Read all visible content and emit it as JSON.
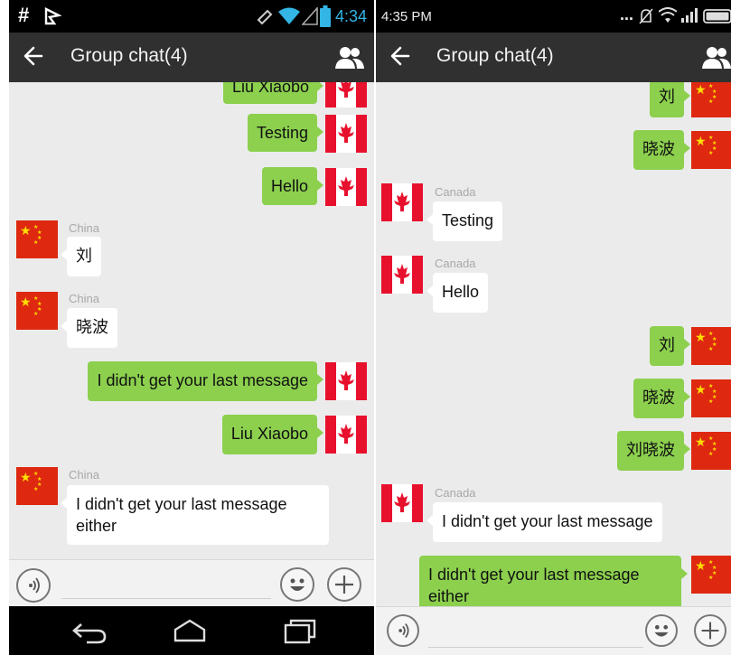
{
  "left_screen": {
    "status": {
      "time": "4:34",
      "hash_icon": "#"
    },
    "header": {
      "title": "Group chat(4)"
    },
    "messages": [
      {
        "text": "Liu Xiaobo"
      },
      {
        "text": "Testing"
      },
      {
        "text": "Hello"
      },
      {
        "sender": "China",
        "text": "刘"
      },
      {
        "sender": "China",
        "text": "晓波"
      },
      {
        "text": "I didn't get your last message"
      },
      {
        "text": "Liu Xiaobo"
      },
      {
        "sender": "China",
        "text": "I didn't get your last message either"
      }
    ]
  },
  "right_screen": {
    "status": {
      "time": "4:35 PM",
      "dots": "..."
    },
    "header": {
      "title": "Group chat(4)"
    },
    "messages": [
      {
        "text": "刘"
      },
      {
        "text": "晓波"
      },
      {
        "sender": "Canada",
        "text": "Testing"
      },
      {
        "sender": "Canada",
        "text": "Hello"
      },
      {
        "text": "刘"
      },
      {
        "text": "晓波"
      },
      {
        "text": "刘晓波"
      },
      {
        "sender": "Canada",
        "text": "I didn't get your last message"
      },
      {
        "text": "I didn't get your last message either"
      }
    ]
  },
  "colors": {
    "outgoing_bubble": "#8cd04e",
    "incoming_bubble": "#ffffff",
    "chat_background": "#ebebeb",
    "app_bar": "#303030",
    "china_red": "#de2910",
    "china_yellow": "#ffde00",
    "canada_red": "#e8112d"
  },
  "icons": [
    "hash-icon",
    "notification-flag-icon",
    "rotate-icon",
    "wifi-icon",
    "signal-icon",
    "battery-icon",
    "back-arrow-icon",
    "group-members-icon",
    "voice-input-icon",
    "emoji-icon",
    "plus-icon",
    "nav-back-icon",
    "nav-home-icon",
    "nav-recents-icon",
    "mute-icon"
  ]
}
